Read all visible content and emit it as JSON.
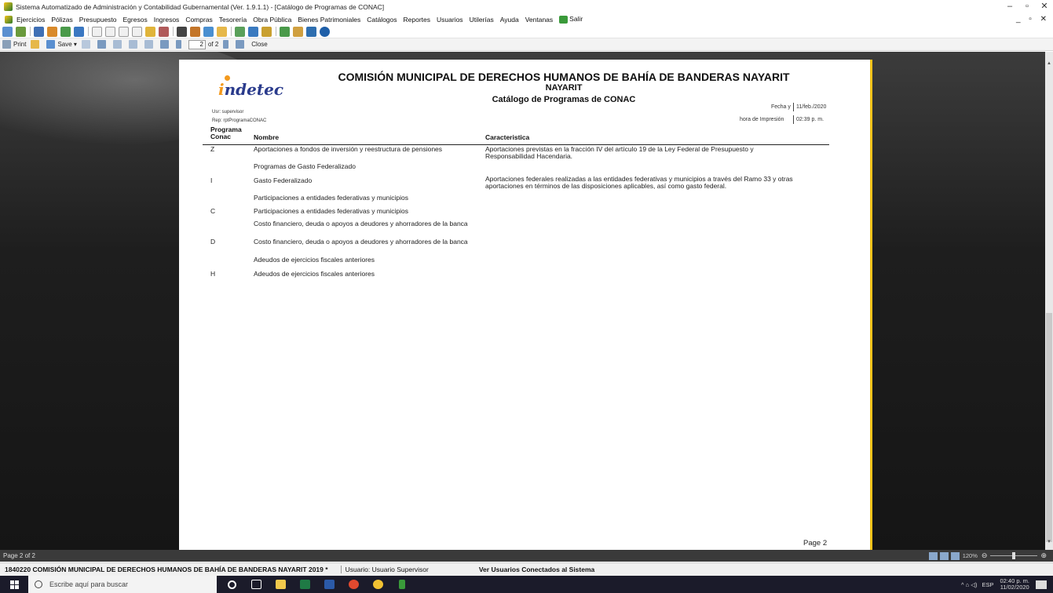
{
  "window": {
    "title": "Sistema Automatizado de Administración y Contabilidad Gubernamental  (Ver. 1.9.1.1) - [Catálogo de Programas de CONAC]",
    "controls": [
      "–",
      "▫",
      "✕"
    ],
    "mdi_controls": "_ ▫ ✕"
  },
  "menu": [
    "Ejercicios",
    "Pólizas",
    "Presupuesto",
    "Egresos",
    "Ingresos",
    "Compras",
    "Tesorería",
    "Obra Pública",
    "Bienes Patrimoniales",
    "Catálogos",
    "Reportes",
    "Usuarios",
    "Utilerías",
    "Ayuda",
    "Ventanas"
  ],
  "menu_salir": "Salir",
  "viewer_toolbar": {
    "print": "Print",
    "save": "Save",
    "page_input": "2",
    "page_of": "of 2",
    "close": "Close"
  },
  "report": {
    "org_name": "COMISIÓN MUNICIPAL DE DERECHOS HUMANOS DE BAHÍA DE BANDERAS NAYARIT",
    "state": "NAYARIT",
    "title": "Catálogo de Programas de CONAC",
    "logo_text_i": "i",
    "logo_text_rest": "ndetec",
    "usr": "Usr: supervisor",
    "rep": "Rep: rptProgramaCONAC",
    "fecha_label": "Fecha y",
    "fecha_value": "11/feb./2020",
    "hora_label": "hora de Impresión",
    "hora_value": "02:39 p. m.",
    "headers": {
      "programa_l1": "Programa",
      "programa_l2": "Conac",
      "nombre": "Nombre",
      "caracteristica": "Caracteristica"
    },
    "rows": [
      {
        "code": "Z",
        "name": "Aportaciones a fondos de inversión y reestructura de pensiones",
        "desc": "Aportaciones previstas en la fracción IV del artículo 19 de la Ley Federal de Presupuesto y Responsabilidad Hacendaria."
      },
      {
        "code": "",
        "name": "Programas de Gasto Federalizado",
        "desc": ""
      },
      {
        "code": "I",
        "name": "Gasto Federalizado",
        "desc": "Aportaciones federales realizadas a las entidades federativas y municipios a través del Ramo 33 y otras aportaciones en términos de las disposiciones aplicables, así como gasto federal."
      },
      {
        "code": "",
        "name": "Participaciones a entidades federativas y municipios",
        "desc": ""
      },
      {
        "code": "C",
        "name": "Participaciones a entidades federativas y municipios",
        "desc": ""
      },
      {
        "code": "",
        "name": "Costo financiero, deuda o apoyos a deudores y ahorradores de la banca",
        "desc": ""
      },
      {
        "code": "D",
        "name": "Costo financiero, deuda o apoyos a deudores y ahorradores de la banca",
        "desc": ""
      },
      {
        "code": "",
        "name": "Adeudos de ejercicios fiscales anteriores",
        "desc": ""
      },
      {
        "code": "H",
        "name": "Adeudos de ejercicios fiscales anteriores",
        "desc": ""
      }
    ],
    "footer_page": "Page 2"
  },
  "statusbar": {
    "page": "Page 2 of 2",
    "zoom": "120%"
  },
  "infobar": {
    "org": "1840220 COMISIÓN MUNICIPAL DE DERECHOS HUMANOS DE BAHÍA DE BANDERAS NAYARIT  2019  *",
    "user": "Usuario: Usuario Supervisor",
    "link": "Ver Usuarios Conectados al Sistema"
  },
  "taskbar": {
    "search_placeholder": "Escribe aquí para buscar",
    "lang": "ESP",
    "time": "02:40 p. m.",
    "date": "11/02/2020",
    "tray_icons": "^  ⌂  ◁)"
  }
}
